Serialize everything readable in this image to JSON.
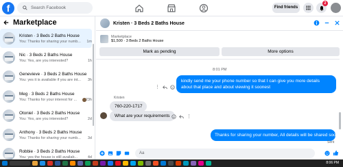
{
  "topbar": {
    "search_placeholder": "Search Facebook",
    "find_friends": "Find friends",
    "notification_count": "2"
  },
  "left": {
    "title": "Marketplace",
    "conversations": [
      {
        "title": "Kristen · 3 Beds 2 Baths House",
        "subtitle": "You: Thanks for sharing your numb...",
        "time": "1m"
      },
      {
        "title": "Nic · 3 Beds 2 Baths House",
        "subtitle": "You: Yes, are you interested?",
        "time": "1h"
      },
      {
        "title": "Genevieve · 3 Beds 2 Baths House",
        "subtitle": "You: yes it is available if you are int...",
        "time": "3h"
      },
      {
        "title": "Meg · 3 Beds 2 Baths House",
        "subtitle": "You: Thanks for your interest for ...",
        "time": "23h"
      },
      {
        "title": "Otoniel · 3 Beds 2 Baths House",
        "subtitle": "You: Yes, are you interested?",
        "time": "2d"
      },
      {
        "title": "Anthony · 3 Beds 2 Baths House",
        "subtitle": "You: Thanks for sharing your numb...",
        "time": "3d"
      },
      {
        "title": "Robbie · 3 Beds 2 Baths House",
        "subtitle": "You: yes the house is still availab...",
        "time": "4d"
      }
    ]
  },
  "chat": {
    "title": "Kristen · 3 Beds 2 Baths House",
    "listing_label": "Marketplace",
    "listing_price": "$1,500 · 3 Beds 2 Baths House",
    "mark_pending": "Mark as pending",
    "more_options": "More options",
    "timestamp": "8:01 PM",
    "msg_out_1": "kindly send me your phone number so that I can give you more details about that place and about viewing it soonest",
    "sender_name": "Kristen",
    "msg_in_1": "760-220-1717",
    "msg_in_2": "What are your requirements",
    "msg_out_2": "Thanks for sharing your number, All details will be shared soonest",
    "sent_label": "Sent",
    "composer_placeholder": "Aa"
  },
  "taskbar": {
    "time": "8:06 PM"
  },
  "colors": {
    "accent": "#0084ff",
    "brand": "#1877f2"
  }
}
